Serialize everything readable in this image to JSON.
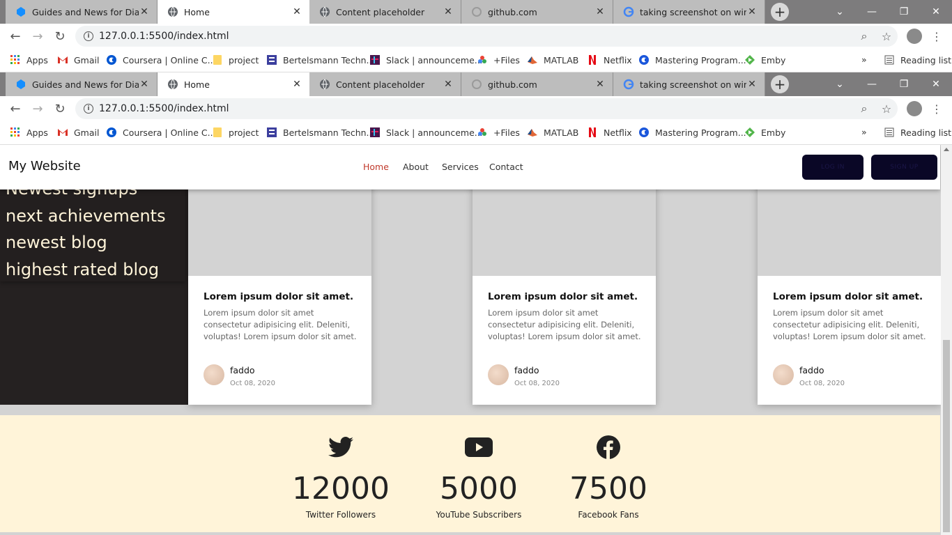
{
  "browser": {
    "tabs": [
      {
        "title": "Guides and News for Diablo",
        "icon": "blizzard-icon",
        "active": false
      },
      {
        "title": "Home",
        "icon": "globe-icon",
        "active": true
      },
      {
        "title": "Content placeholder",
        "icon": "globe-icon",
        "active": false
      },
      {
        "title": "github.com",
        "icon": "loading-icon",
        "active": false
      },
      {
        "title": "taking screenshot on window",
        "icon": "google-icon",
        "active": false
      }
    ],
    "url": "127.0.0.1:5500/index.html",
    "bookmarks": [
      {
        "label": "Apps",
        "icon": "apps-grid-icon"
      },
      {
        "label": "Gmail",
        "icon": "gmail-icon"
      },
      {
        "label": "Coursera | Online C...",
        "icon": "coursera-icon"
      },
      {
        "label": "project",
        "icon": "folder-icon"
      },
      {
        "label": "Bertelsmann Techn...",
        "icon": "bertelsmann-icon"
      },
      {
        "label": "Slack | announceme...",
        "icon": "slack-icon"
      },
      {
        "label": "+Files",
        "icon": "files-icon"
      },
      {
        "label": "MATLAB",
        "icon": "matlab-icon"
      },
      {
        "label": "Netflix",
        "icon": "netflix-icon"
      },
      {
        "label": "Mastering Program...",
        "icon": "mastering-icon"
      },
      {
        "label": "Emby",
        "icon": "emby-icon"
      }
    ],
    "more_bookmarks": "»",
    "reading_list": "Reading list"
  },
  "site": {
    "brand": "My Website",
    "nav": [
      {
        "label": "Home",
        "active": true
      },
      {
        "label": "About",
        "active": false
      },
      {
        "label": "Services",
        "active": false
      },
      {
        "label": "Contact",
        "active": false
      }
    ],
    "login_label": "LOG IN",
    "signup_label": "SIGN UP",
    "sidebar_items": [
      "Newest signups",
      "next achievements",
      "newest blog",
      "highest rated blog"
    ],
    "cards": [
      {
        "title": "Lorem ipsum dolor sit amet.",
        "desc": "Lorem ipsum dolor sit amet consectetur adipisicing elit. Deleniti, voluptas! Lorem ipsum dolor sit amet.",
        "author": "faddo",
        "date": "Oct 08, 2020"
      },
      {
        "title": "Lorem ipsum dolor sit amet.",
        "desc": "Lorem ipsum dolor sit amet consectetur adipisicing elit. Deleniti, voluptas! Lorem ipsum dolor sit amet.",
        "author": "faddo",
        "date": "Oct 08, 2020"
      },
      {
        "title": "Lorem ipsum dolor sit amet.",
        "desc": "Lorem ipsum dolor sit amet consectetur adipisicing elit. Deleniti, voluptas! Lorem ipsum dolor sit amet.",
        "author": "faddo",
        "date": "Oct 08, 2020"
      }
    ],
    "stats": [
      {
        "icon": "twitter-icon",
        "value": "12000",
        "label": "Twitter Followers"
      },
      {
        "icon": "youtube-icon",
        "value": "5000",
        "label": "YouTube Subscribers"
      },
      {
        "icon": "facebook-icon",
        "value": "7500",
        "label": "Facebook Fans"
      }
    ]
  },
  "colors": {
    "sidebar_bg": "#252121",
    "sidebar_text": "#fff4d9",
    "stats_bg": "#fff4d9",
    "nav_active": "#c0392b",
    "button_bg": "#0a0726"
  }
}
